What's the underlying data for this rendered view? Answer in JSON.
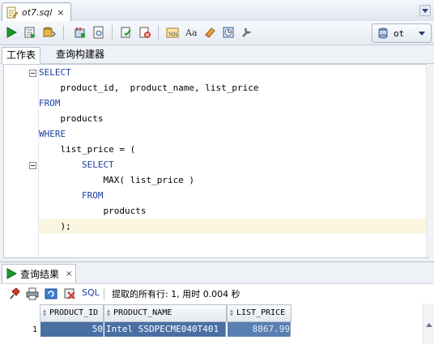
{
  "file_tab": {
    "label": "ot7.sql",
    "close": "×"
  },
  "toolbar": {
    "icons": [
      "run-statement-icon",
      "run-script-icon",
      "commit-icon",
      "rollback-icon",
      "explain-plan-icon",
      "autotrace-icon",
      "sql-tuning-icon",
      "clear-icon",
      "format-icon",
      "case-icon",
      "eraser-icon",
      "history-icon",
      "tools-icon"
    ],
    "connection": "ot"
  },
  "subtabs": {
    "worksheet": "工作表",
    "query_builder": "查询构建器"
  },
  "editor": {
    "lines": [
      {
        "kw": "SELECT",
        "text": ""
      },
      {
        "kw": "",
        "text": "    product_id,  product_name, list_price"
      },
      {
        "kw": "FROM",
        "text": ""
      },
      {
        "kw": "",
        "text": "    products"
      },
      {
        "kw": "WHERE",
        "text": ""
      },
      {
        "kw": "",
        "text": "    list_price = ("
      },
      {
        "kw": "        SELECT",
        "text": ""
      },
      {
        "kw": "",
        "text": "            MAX( list_price )"
      },
      {
        "kw": "        FROM",
        "text": ""
      },
      {
        "kw": "",
        "text": "            products"
      },
      {
        "kw": "",
        "text": "    );"
      }
    ]
  },
  "results": {
    "tab_label": "查询结果",
    "close": "×",
    "sql_link": "SQL",
    "status": "提取的所有行: 1, 用时 0.004 秒",
    "columns": [
      "PRODUCT_ID",
      "PRODUCT_NAME",
      "LIST_PRICE"
    ],
    "rows": [
      {
        "num": "1",
        "product_id": "50",
        "product_name": "Intel SSDPECME040T401",
        "list_price": "8867.99"
      }
    ]
  },
  "colors": {
    "keyword": "#1a3fa5",
    "selection": "#4a6fa3",
    "current_line": "#fbf6df"
  }
}
